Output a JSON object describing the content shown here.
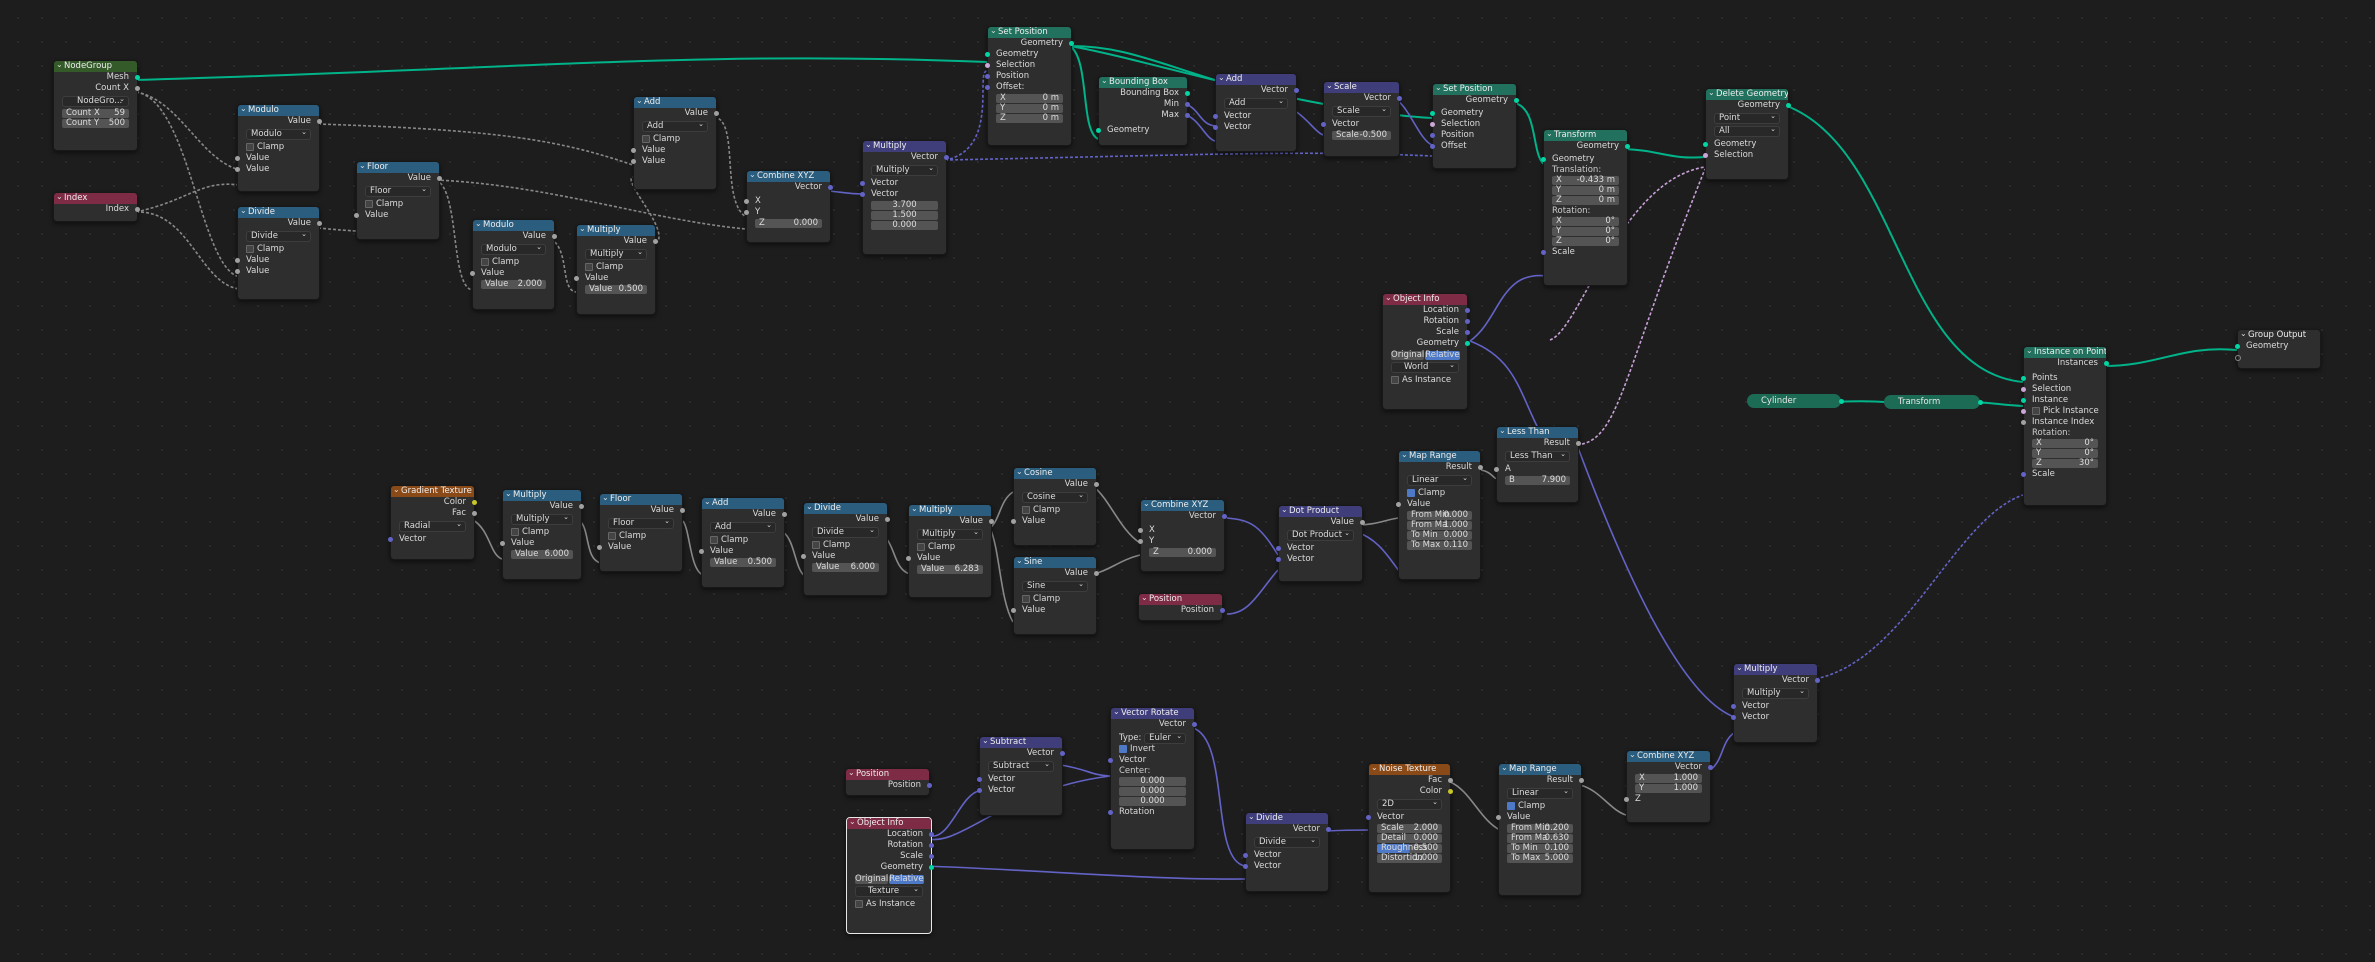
{
  "nodes": {
    "nodegroup": {
      "title": "NodeGroup",
      "out_mesh": "Mesh",
      "out_countx": "Count X",
      "datablock": "NodeGro...",
      "count_x_label": "Count X",
      "count_x": "59",
      "count_y_label": "Count Y",
      "count_y": "500"
    },
    "index": {
      "title": "Index",
      "out": "Index"
    },
    "modulo1": {
      "title": "Modulo",
      "out": "Value",
      "op": "Modulo",
      "clamp": "Clamp",
      "in1": "Value",
      "in2": "Value"
    },
    "divide1": {
      "title": "Divide",
      "out": "Value",
      "op": "Divide",
      "clamp": "Clamp",
      "in1": "Value",
      "in2": "Value"
    },
    "floor1": {
      "title": "Floor",
      "out": "Value",
      "op": "Floor",
      "clamp": "Clamp",
      "in1": "Value"
    },
    "modulo2": {
      "title": "Modulo",
      "out": "Value",
      "op": "Modulo",
      "clamp": "Clamp",
      "in1": "Value",
      "in2_label": "Value",
      "in2": "2.000"
    },
    "multiply1": {
      "title": "Multiply",
      "out": "Value",
      "op": "Multiply",
      "clamp": "Clamp",
      "in1": "Value",
      "in2_label": "Value",
      "in2": "0.500"
    },
    "add1": {
      "title": "Add",
      "out": "Value",
      "op": "Add",
      "clamp": "Clamp",
      "in1": "Value",
      "in2": "Value"
    },
    "combine1": {
      "title": "Combine XYZ",
      "out": "Vector",
      "x": "X",
      "y": "Y",
      "z_label": "Z",
      "z": "0.000"
    },
    "multiplyv1": {
      "title": "Multiply",
      "out": "Vector",
      "op": "Multiply",
      "in1": "Vector",
      "in2": "Vector",
      "v1": "3.700",
      "v2": "1.500",
      "v3": "0.000"
    },
    "setpos1": {
      "title": "Set Position",
      "out": "Geometry",
      "in_geo": "Geometry",
      "in_sel": "Selection",
      "in_pos": "Position",
      "in_off": "Offset:",
      "x_label": "X",
      "x": "0 m",
      "y_label": "Y",
      "y": "0 m",
      "z_label": "Z",
      "z": "0 m"
    },
    "bbox": {
      "title": "Bounding Box",
      "out1": "Bounding Box",
      "out2": "Min",
      "out3": "Max",
      "in": "Geometry"
    },
    "addv": {
      "title": "Add",
      "out": "Vector",
      "op": "Add",
      "in1": "Vector",
      "in2": "Vector"
    },
    "scale": {
      "title": "Scale",
      "out": "Vector",
      "op": "Scale",
      "in": "Vector",
      "s_label": "Scale",
      "s": "-0.500"
    },
    "setpos2": {
      "title": "Set Position",
      "out": "Geometry",
      "in_geo": "Geometry",
      "in_sel": "Selection",
      "in_pos": "Position",
      "in_off": "Offset"
    },
    "transform1": {
      "title": "Transform",
      "out": "Geometry",
      "in": "Geometry",
      "trans": "Translation:",
      "tx_label": "X",
      "tx": "-0.433 m",
      "ty_label": "Y",
      "ty": "0 m",
      "tz_label": "Z",
      "tz": "0 m",
      "rot": "Rotation:",
      "rx_label": "X",
      "rx": "0°",
      "ry_label": "Y",
      "ry": "0°",
      "rz_label": "Z",
      "rz": "0°",
      "scale": "Scale"
    },
    "deletegeo": {
      "title": "Delete Geometry",
      "out": "Geometry",
      "d1": "Point",
      "d2": "All",
      "in_geo": "Geometry",
      "in_sel": "Selection"
    },
    "objinfo1": {
      "title": "Object Info",
      "o1": "Location",
      "o2": "Rotation",
      "o3": "Scale",
      "o4": "Geometry",
      "t1": "Original",
      "t2": "Relative",
      "obj": "World",
      "asinst": "As Instance"
    },
    "lessthan": {
      "title": "Less Than",
      "out": "Result",
      "op": "Less Than",
      "a": "A",
      "b_label": "B",
      "b": "7.900"
    },
    "iop": {
      "title": "Instance on Points",
      "out": "Instances",
      "i1": "Points",
      "i2": "Selection",
      "i3": "Instance",
      "i4": "Pick Instance",
      "i5": "Instance Index",
      "i6": "Rotation:",
      "rx_label": "X",
      "rx": "0°",
      "ry_label": "Y",
      "ry": "0°",
      "rz_label": "Z",
      "rz": "30°",
      "i7": "Scale"
    },
    "groupout": {
      "title": "Group Output",
      "in": "Geometry"
    },
    "cylinder": {
      "title": "Cylinder"
    },
    "transform2": {
      "title": "Transform"
    },
    "gradtex": {
      "title": "Gradient Texture",
      "o1": "Color",
      "o2": "Fac",
      "type": "Radial",
      "in": "Vector"
    },
    "multiply2": {
      "title": "Multiply",
      "out": "Value",
      "op": "Multiply",
      "clamp": "Clamp",
      "in1": "Value",
      "in2_label": "Value",
      "in2": "6.000"
    },
    "floor2": {
      "title": "Floor",
      "out": "Value",
      "op": "Floor",
      "clamp": "Clamp",
      "in1": "Value"
    },
    "add2": {
      "title": "Add",
      "out": "Value",
      "op": "Add",
      "clamp": "Clamp",
      "in1": "Value",
      "in2_label": "Value",
      "in2": "0.500"
    },
    "divide2": {
      "title": "Divide",
      "out": "Value",
      "op": "Divide",
      "clamp": "Clamp",
      "in1": "Value",
      "in2_label": "Value",
      "in2": "6.000"
    },
    "multiply3": {
      "title": "Multiply",
      "out": "Value",
      "op": "Multiply",
      "clamp": "Clamp",
      "in1": "Value",
      "in2_label": "Value",
      "in2": "6.283"
    },
    "cosine": {
      "title": "Cosine",
      "out": "Value",
      "op": "Cosine",
      "clamp": "Clamp",
      "in1": "Value"
    },
    "sine": {
      "title": "Sine",
      "out": "Value",
      "op": "Sine",
      "clamp": "Clamp",
      "in1": "Value"
    },
    "combine2": {
      "title": "Combine XYZ",
      "out": "Vector",
      "x": "X",
      "y": "Y",
      "z_label": "Z",
      "z": "0.000"
    },
    "position1": {
      "title": "Position",
      "out": "Position"
    },
    "dot": {
      "title": "Dot Product",
      "out": "Value",
      "op": "Dot Product",
      "in1": "Vector",
      "in2": "Vector"
    },
    "maprange1": {
      "title": "Map Range",
      "out": "Result",
      "op": "Linear",
      "clamp": "Clamp",
      "in": "Value",
      "f1_label": "From Min",
      "f1": "0.000",
      "f2_label": "From Ma",
      "f2": "1.000",
      "f3_label": "To Min",
      "f3": "0.000",
      "f4_label": "To Max",
      "f4": "0.110"
    },
    "multiplyv2": {
      "title": "Multiply",
      "out": "Vector",
      "op": "Multiply",
      "in1": "Vector",
      "in2": "Vector"
    },
    "position2": {
      "title": "Position",
      "out": "Position"
    },
    "objinfo2": {
      "title": "Object Info",
      "o1": "Location",
      "o2": "Rotation",
      "o3": "Scale",
      "o4": "Geometry",
      "t1": "Original",
      "t2": "Relative",
      "obj": "Texture",
      "asinst": "As Instance"
    },
    "subtract": {
      "title": "Subtract",
      "out": "Vector",
      "op": "Subtract",
      "in1": "Vector",
      "in2": "Vector"
    },
    "vecrot": {
      "title": "Vector Rotate",
      "out": "Vector",
      "type_label": "Type:",
      "type": "Euler",
      "invert": "Invert",
      "in1": "Vector",
      "center": "Center:",
      "c1": "0.000",
      "c2": "0.000",
      "c3": "0.000",
      "rot": "Rotation"
    },
    "dividev": {
      "title": "Divide",
      "out": "Vector",
      "op": "Divide",
      "in1": "Vector",
      "in2": "Vector"
    },
    "noise": {
      "title": "Noise Texture",
      "o1": "Fac",
      "o2": "Color",
      "dim": "2D",
      "in": "Vector",
      "s_label": "Scale",
      "s": "2.000",
      "d_label": "Detail",
      "d": "0.000",
      "r_label": "Roughness",
      "r": "0.500",
      "di_label": "Distortion",
      "di": "1.000"
    },
    "maprange2": {
      "title": "Map Range",
      "out": "Result",
      "op": "Linear",
      "clamp": "Clamp",
      "in": "Value",
      "f1_label": "From Min",
      "f1": "0.200",
      "f2_label": "From Ma",
      "f2": "0.630",
      "f3_label": "To Min",
      "f3": "0.100",
      "f4_label": "To Max",
      "f4": "5.000"
    },
    "combine3": {
      "title": "Combine XYZ",
      "out": "Vector",
      "x_label": "X",
      "x": "1.000",
      "y_label": "Y",
      "y": "1.000",
      "z": "Z"
    }
  }
}
